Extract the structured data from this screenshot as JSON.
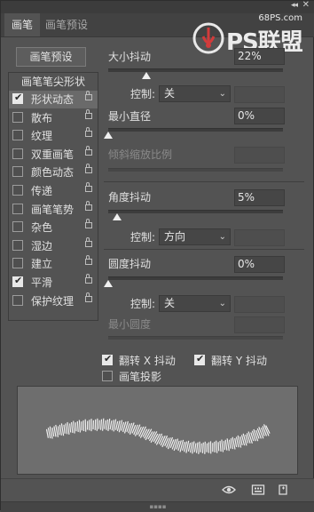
{
  "window": {
    "collapse_glyph": "◂◂",
    "close_glyph": "✕"
  },
  "tabs": [
    {
      "label": "画笔"
    },
    {
      "label": "画笔预设"
    }
  ],
  "watermark": {
    "site": "68PS.com",
    "text": "PS联盟"
  },
  "presets_button": {
    "label": "画笔预设"
  },
  "sidebar": {
    "header": "画笔笔尖形状",
    "items": [
      {
        "label": "形状动态",
        "checked": true,
        "selected": true
      },
      {
        "label": "散布",
        "checked": false
      },
      {
        "label": "纹理",
        "checked": false
      },
      {
        "label": "双重画笔",
        "checked": false
      },
      {
        "label": "颜色动态",
        "checked": false
      },
      {
        "label": "传递",
        "checked": false
      },
      {
        "label": "画笔笔势",
        "checked": false
      },
      {
        "label": "杂色",
        "checked": false
      },
      {
        "label": "湿边",
        "checked": false
      },
      {
        "label": "建立",
        "checked": false
      },
      {
        "label": "平滑",
        "checked": true
      },
      {
        "label": "保护纹理",
        "checked": false
      }
    ]
  },
  "settings": {
    "size_jitter": {
      "label": "大小抖动",
      "value": "22%",
      "level": 0.22
    },
    "size_control": {
      "label": "控制:",
      "value": "关"
    },
    "min_diameter": {
      "label": "最小直径",
      "value": "0%",
      "level": 0
    },
    "tilt_scale": {
      "label": "倾斜缩放比例"
    },
    "angle_jitter": {
      "label": "角度抖动",
      "value": "5%",
      "level": 0.05
    },
    "angle_control": {
      "label": "控制:",
      "value": "方向"
    },
    "roundness_jitter": {
      "label": "圆度抖动",
      "value": "0%",
      "level": 0
    },
    "roundness_control": {
      "label": "控制:",
      "value": "关"
    },
    "min_roundness": {
      "label": "最小圆度"
    }
  },
  "options": {
    "flip_x": {
      "label": "翻转 X 抖动",
      "checked": true
    },
    "flip_y": {
      "label": "翻转 Y 抖动",
      "checked": true
    },
    "brush_projection": {
      "label": "画笔投影",
      "checked": false
    }
  },
  "colors": {
    "panel": "#535353",
    "preview": "#6e6e6e",
    "stroke": "#f2f2f2"
  },
  "bottom_icons": [
    "eye-icon",
    "brush-panel-icon",
    "new-preset-icon"
  ]
}
